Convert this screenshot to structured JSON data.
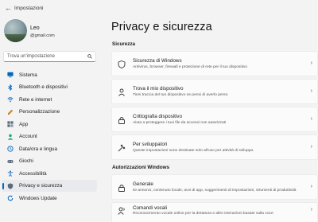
{
  "window": {
    "title": "Impostazioni"
  },
  "profile": {
    "name": "Leo",
    "email": "@gmail.com"
  },
  "search": {
    "placeholder": "Trova un'impostazione"
  },
  "nav": [
    {
      "label": "Sistema",
      "icon": "monitor-icon",
      "color": "#0067c0"
    },
    {
      "label": "Bluetooth e dispositivi",
      "icon": "bluetooth-icon",
      "color": "#0067c0"
    },
    {
      "label": "Rete e internet",
      "icon": "wifi-icon",
      "color": "#0067c0"
    },
    {
      "label": "Personalizzazione",
      "icon": "brush-icon",
      "color": "#d08a26"
    },
    {
      "label": "App",
      "icon": "apps-icon",
      "color": "#5a6a7a"
    },
    {
      "label": "Account",
      "icon": "person-icon",
      "color": "#2aa06b"
    },
    {
      "label": "Data/ora e lingua",
      "icon": "globe-clock-icon",
      "color": "#0067c0"
    },
    {
      "label": "Giochi",
      "icon": "gamepad-icon",
      "color": "#5a6a7a"
    },
    {
      "label": "Accessibilità",
      "icon": "accessibility-icon",
      "color": "#1a6fcf"
    },
    {
      "label": "Privacy e sicurezza",
      "icon": "shield-icon",
      "color": "#5a6a7a",
      "active": true
    },
    {
      "label": "Windows Update",
      "icon": "update-icon",
      "color": "#0067c0"
    }
  ],
  "page_title": "Privacy e sicurezza",
  "sections": [
    {
      "title": "Sicurezza",
      "items": [
        {
          "title": "Sicurezza di Windows",
          "desc": "Antivirus, browser, firewall e protezione di rete per il tuo dispositivo",
          "icon": "shield-icon"
        },
        {
          "title": "Trova il mio dispositivo",
          "desc": "Tieni traccia del tuo dispositivo se pensi di averlo perso",
          "icon": "person-pin-icon"
        },
        {
          "title": "Crittografia dispositivo",
          "desc": "Aiuta a proteggere i tuoi file da accessi non autorizzati",
          "icon": "lock-icon"
        },
        {
          "title": "Per sviluppatori",
          "desc": "Queste impostazioni sono destinate solo all'uso per attività di sviluppo.",
          "icon": "tools-icon"
        }
      ]
    },
    {
      "title": "Autorizzazioni Windows",
      "items": [
        {
          "title": "Generale",
          "desc": "ID annunci, contenuto locale, avvi di app, suggerimenti di impostazioni, strumenti di produttività",
          "icon": "lock-icon"
        },
        {
          "title": "Comandi vocali",
          "desc": "Riconoscimento vocale online per la dettatura e altre interazioni basate sulla voce",
          "icon": "speech-icon"
        }
      ]
    }
  ]
}
